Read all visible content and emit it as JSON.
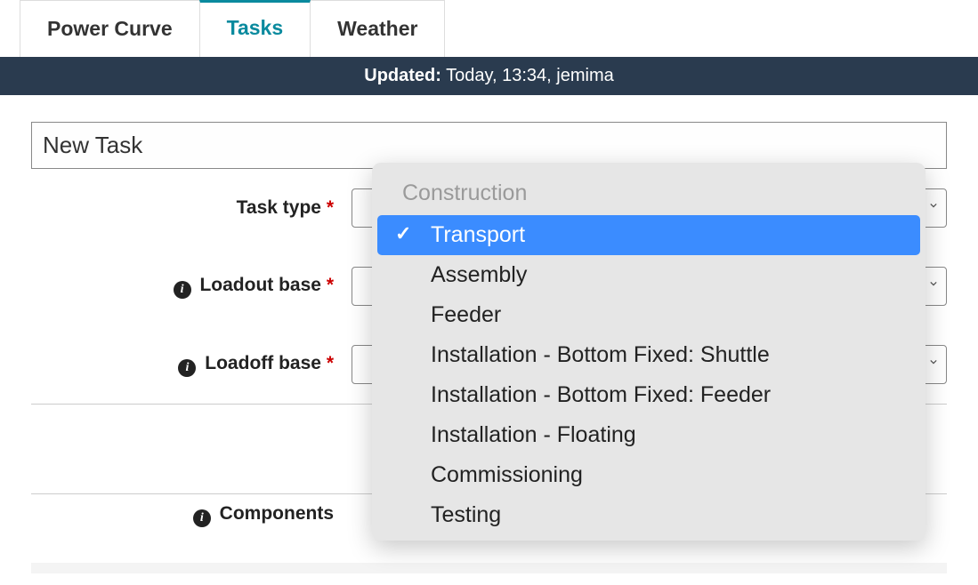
{
  "tabs": [
    {
      "label": "Power Curve",
      "active": false
    },
    {
      "label": "Tasks",
      "active": true
    },
    {
      "label": "Weather",
      "active": false
    }
  ],
  "updateBar": {
    "label": "Updated:",
    "value": " Today, 13:34, jemima"
  },
  "form": {
    "titleValue": "New Task",
    "taskType": {
      "label": "Task type",
      "required": "*"
    },
    "loadoutBase": {
      "label": "Loadout base",
      "required": "*"
    },
    "loadoffBase": {
      "label": "Loadoff base",
      "required": "*"
    },
    "components": {
      "label": "Components"
    }
  },
  "popup": {
    "groupLabel": "Construction",
    "selectedIndex": 0,
    "options": [
      "Transport",
      "Assembly",
      "Feeder",
      "Installation - Bottom Fixed: Shuttle",
      "Installation - Bottom Fixed: Feeder",
      "Installation - Floating",
      "Commissioning",
      "Testing"
    ]
  }
}
